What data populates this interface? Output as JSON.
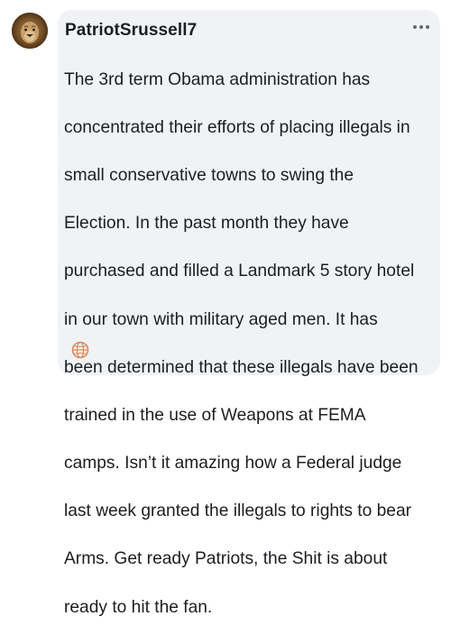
{
  "comment": {
    "author": "PatriotSrussell7",
    "more_icon": "more-horizontal-icon",
    "text_lines": [
      "The 3rd term Obama administration has",
      "concentrated their efforts of placing illegals in",
      "small conservative towns to swing the",
      "Election. In the past month they have",
      "purchased and filled a Landmark 5 story hotel",
      "in our town with military aged men. It has",
      "been determined that these illegals have been",
      "trained in the use of Weapons at FEMA",
      "camps. Isn’t it amazing how a Federal judge",
      "last week granted the illegals to rights to bear",
      "Arms. Get ready Patriots, the Shit is about",
      "ready to hit the fan."
    ],
    "avatar_icon": "lion-avatar-icon",
    "translate_icon": "globe-translate-icon"
  },
  "colors": {
    "bubble_background": "#f0f2f5",
    "text": "#1c1e21",
    "secondary": "#65676b",
    "translate_accent": "#e08a5a"
  }
}
